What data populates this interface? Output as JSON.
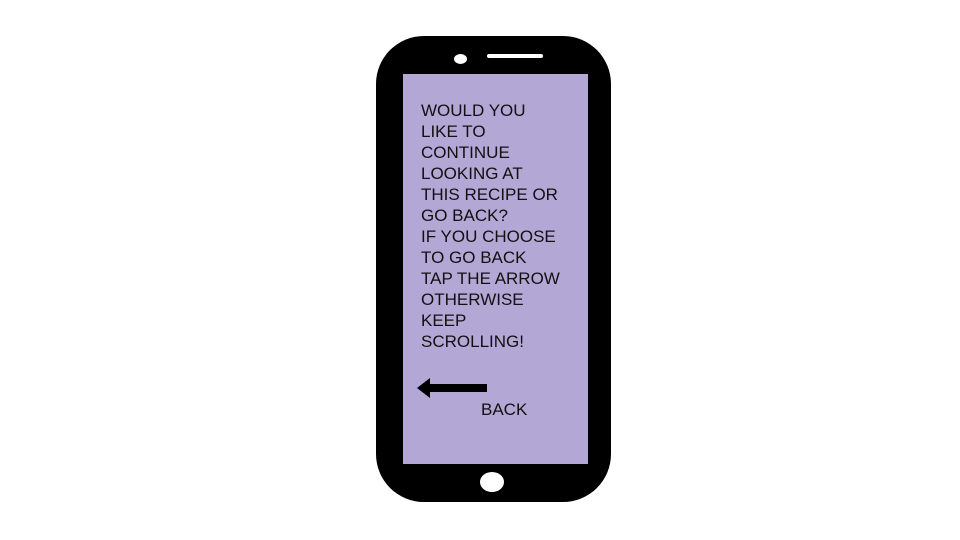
{
  "colors": {
    "background": "#ffffff",
    "phone_body": "#000000",
    "screen": "#b3a7d6",
    "text": "#111111",
    "arrow": "#000000"
  },
  "screen": {
    "message_lines": [
      "WOULD YOU",
      "LIKE TO",
      "CONTINUE",
      "LOOKING AT",
      "THIS RECIPE OR",
      "GO BACK?",
      "IF YOU CHOOSE",
      "TO GO BACK",
      "TAP THE ARROW",
      "OTHERWISE",
      "KEEP",
      "SCROLLING!"
    ],
    "back_label": "BACK",
    "back_icon": "left-arrow-icon"
  }
}
